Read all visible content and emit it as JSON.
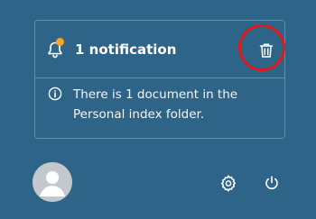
{
  "notification": {
    "title": "1 notification",
    "unread_dot_color": "#f5a623",
    "message": "There is 1 document in the Personal index folder."
  },
  "icons": {
    "bell": "bell-icon",
    "trash": "trash-icon",
    "info": "info-icon",
    "user": "user-avatar-icon",
    "settings": "gear-icon",
    "power": "power-icon"
  },
  "highlight": {
    "color": "#e01818",
    "target": "delete-notification-button"
  },
  "theme": {
    "background": "#2e6488",
    "border": "#5f8fae",
    "text": "#ffffff"
  }
}
